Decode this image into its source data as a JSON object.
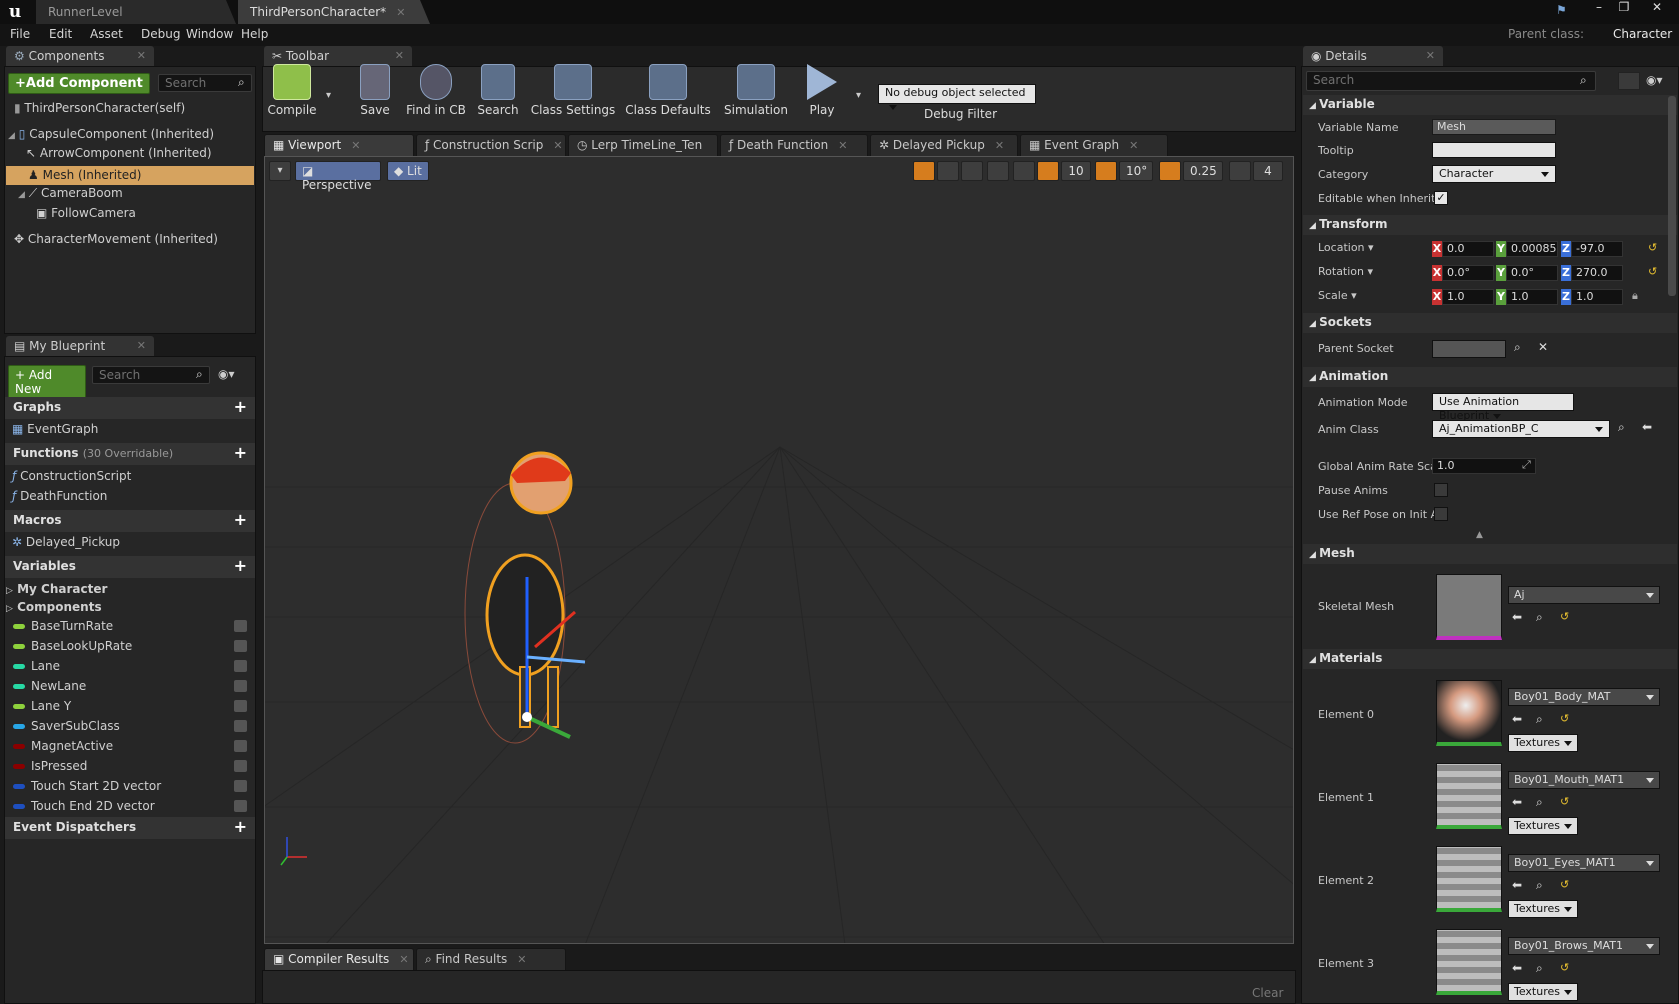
{
  "titlebar": {
    "tabs": [
      "RunnerLevel",
      "ThirdPersonCharacter*"
    ],
    "window_controls": [
      "–",
      "❐",
      "✕"
    ]
  },
  "menubar": {
    "items": [
      "File",
      "Edit",
      "Asset",
      "Debug",
      "Window",
      "Help"
    ],
    "parent_class_label": "Parent class:",
    "parent_class_value": "Character"
  },
  "components": {
    "tab": "Components",
    "add_component": "+Add Component",
    "search_placeholder": "Search",
    "tree": [
      "ThirdPersonCharacter(self)",
      "CapsuleComponent (Inherited)",
      "ArrowComponent (Inherited)",
      "Mesh (Inherited)",
      "CameraBoom",
      "FollowCamera",
      "CharacterMovement (Inherited)"
    ]
  },
  "blueprint": {
    "tab": "My Blueprint",
    "add_new": "+ Add New",
    "search_placeholder": "Search",
    "graphs_label": "Graphs",
    "graphs": [
      "EventGraph"
    ],
    "functions_label": "Functions",
    "functions_override": "(30 Overridable)",
    "functions": [
      "ConstructionScript",
      "DeathFunction"
    ],
    "macros_label": "Macros",
    "macros": [
      "Delayed_Pickup"
    ],
    "variables_label": "Variables",
    "var_groups": [
      "My Character",
      "Components"
    ],
    "variables": [
      {
        "name": "BaseTurnRate",
        "color": "#8ed13c"
      },
      {
        "name": "BaseLookUpRate",
        "color": "#8ed13c"
      },
      {
        "name": "Lane",
        "color": "#27d8a4"
      },
      {
        "name": "NewLane",
        "color": "#27d8a4"
      },
      {
        "name": "Lane Y",
        "color": "#8ed13c"
      },
      {
        "name": "SaverSubClass",
        "color": "#28a6e6"
      },
      {
        "name": "MagnetActive",
        "color": "#8b0000"
      },
      {
        "name": "IsPressed",
        "color": "#8b0000"
      },
      {
        "name": "Touch Start 2D vector",
        "color": "#1e4fbf"
      },
      {
        "name": "Touch End 2D vector",
        "color": "#1e4fbf"
      }
    ],
    "dispatchers_label": "Event Dispatchers"
  },
  "toolbar": {
    "tab": "Toolbar",
    "buttons": [
      "Compile",
      "Save",
      "Find in CB",
      "Search",
      "Class Settings",
      "Class Defaults",
      "Simulation",
      "Play"
    ],
    "debug_select": "No debug object selected",
    "debug_filter": "Debug Filter"
  },
  "graph_tabs": [
    "Viewport",
    "Construction Scrip",
    "Lerp TimeLine_Ten",
    "Death Function",
    "Delayed Pickup",
    "Event Graph"
  ],
  "viewport": {
    "perspective": "Perspective",
    "lit": "Lit",
    "grid_snap": "10",
    "rot_snap": "10°",
    "scale_snap": "0.25",
    "cam_speed": "4"
  },
  "bottom": {
    "tabs": [
      "Compiler Results",
      "Find Results"
    ],
    "clear": "Clear"
  },
  "details": {
    "tab": "Details",
    "search_placeholder": "Search",
    "variable_section": "Variable",
    "var_name_label": "Variable Name",
    "var_name": "Mesh",
    "tooltip_label": "Tooltip",
    "category_label": "Category",
    "category": "Character",
    "editable_label": "Editable when Inherite",
    "transform_section": "Transform",
    "location_label": "Location",
    "rotation_label": "Rotation",
    "scale_label": "Scale",
    "location": [
      "0.0",
      "0.00085",
      "-97.0"
    ],
    "rotation": [
      "0.0°",
      "0.0°",
      "270.0"
    ],
    "scale": [
      "1.0",
      "1.0",
      "1.0"
    ],
    "sockets_section": "Sockets",
    "parent_socket_label": "Parent Socket",
    "animation_section": "Animation",
    "anim_mode_label": "Animation Mode",
    "anim_mode": "Use Animation Blueprint",
    "anim_class_label": "Anim Class",
    "anim_class": "Aj_AnimationBP_C",
    "rate_label": "Global Anim Rate Scal",
    "rate": "1.0",
    "pause_label": "Pause Anims",
    "refpose_label": "Use Ref Pose on Init A",
    "mesh_section": "Mesh",
    "skeletal_label": "Skeletal Mesh",
    "skeletal": "Aj",
    "materials_section": "Materials",
    "elements": [
      {
        "label": "Element 0",
        "mat": "Boy01_Body_MAT",
        "textures": "Textures"
      },
      {
        "label": "Element 1",
        "mat": "Boy01_Mouth_MAT1",
        "textures": "Textures"
      },
      {
        "label": "Element 2",
        "mat": "Boy01_Eyes_MAT1",
        "textures": "Textures"
      },
      {
        "label": "Element 3",
        "mat": "Boy01_Brows_MAT1",
        "textures": "Textures"
      }
    ]
  }
}
